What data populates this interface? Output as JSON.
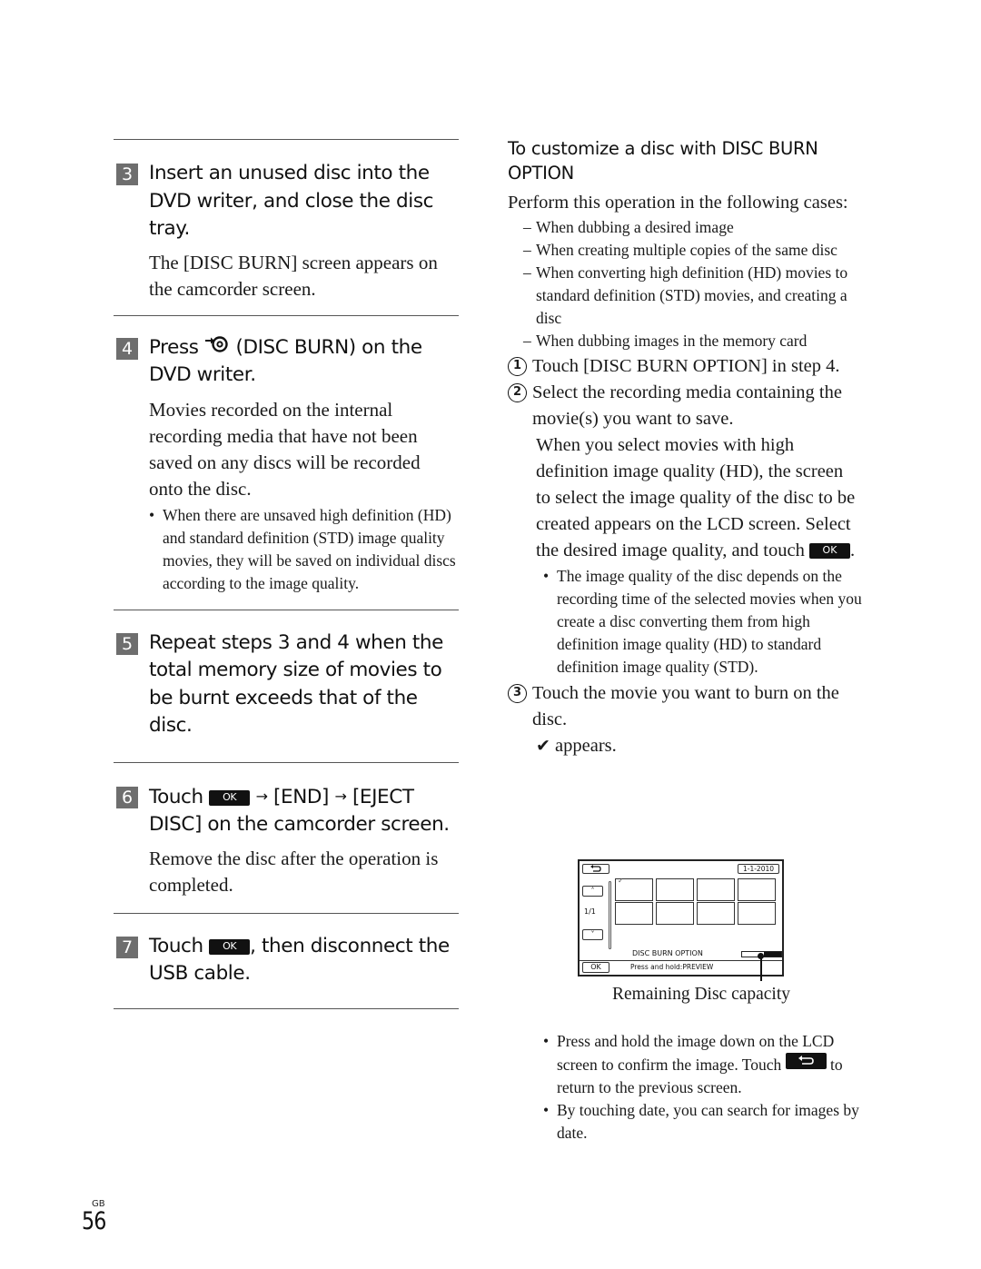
{
  "left_column": {
    "steps": [
      {
        "number": "3",
        "title": "Insert an unused disc into the DVD writer, and close the disc tray.",
        "body": "The [DISC BURN] screen appears on the camcorder screen."
      },
      {
        "number": "4",
        "title_prefix": "Press",
        "title_icon": "disc-burn-icon",
        "title_suffix": "(DISC BURN) on the DVD writer.",
        "body": "Movies recorded on the internal recording media that have not been saved on any discs will be recorded onto the disc.",
        "bullets": [
          "When there are unsaved high definition (HD) and standard definition (STD) image quality movies, they will be saved on individual discs according to the image quality."
        ]
      },
      {
        "number": "5",
        "title": "Repeat steps 3 and 4 when the total memory size of movies to be burnt exceeds that of the disc."
      },
      {
        "number": "6",
        "title_prefix": "Touch",
        "ok_label": "OK",
        "arrow": "→",
        "title_mid": "[END]",
        "title_suffix": "[EJECT DISC] on the camcorder screen.",
        "body": "Remove the disc after the operation is completed."
      },
      {
        "number": "7",
        "title_prefix": "Touch",
        "ok_label": "OK",
        "title_suffix": ", then disconnect the USB cable."
      }
    ]
  },
  "right_column": {
    "heading": "To customize a disc with DISC BURN OPTION",
    "intro": "Perform this operation in the following cases:",
    "cases": [
      "When dubbing a desired image",
      "When creating multiple copies of the same disc",
      "When converting high definition (HD) movies to standard definition (STD) movies, and creating a disc",
      "When dubbing images in the memory card"
    ],
    "procedure": [
      {
        "num": "1",
        "text": "Touch [DISC BURN OPTION] in step 4."
      },
      {
        "num": "2",
        "text": "Select the recording media containing the movie(s) you want to save.",
        "detail": "When you select movies with high definition image quality (HD), the screen to select the image quality of the disc to be created appears on the LCD screen. Select the desired image quality, and touch",
        "detail_end": ".",
        "ok_label": "OK",
        "bullets": [
          "The image quality of the disc depends on the recording time of the selected movies when you create a disc converting them from high definition image quality (HD) to standard definition image quality (STD)."
        ]
      },
      {
        "num": "3",
        "text": "Touch the movie you want to burn on the disc.",
        "check_glyph": "✔",
        "appears": "appears."
      }
    ],
    "lcd_screen": {
      "back_icon": "back-arrow-icon",
      "date": "1-1-2010",
      "page": "1/1",
      "title": "DISC BURN OPTION",
      "ok": "OK",
      "hint": "Press and hold:PREVIEW",
      "thumbnail_count": 8,
      "selected_thumbnail": 1,
      "disc_capacity_used_fraction": 0.45
    },
    "capacity_caption": "Remaining Disc capacity",
    "notes": [
      {
        "before": "Press and hold the image down on the LCD screen to confirm the image. Touch",
        "icon": "back-arrow-icon",
        "after": "to return to the previous screen."
      },
      {
        "text": "By touching date, you can search for images by date."
      }
    ]
  },
  "footer": {
    "region": "GB",
    "page_number": "56"
  }
}
